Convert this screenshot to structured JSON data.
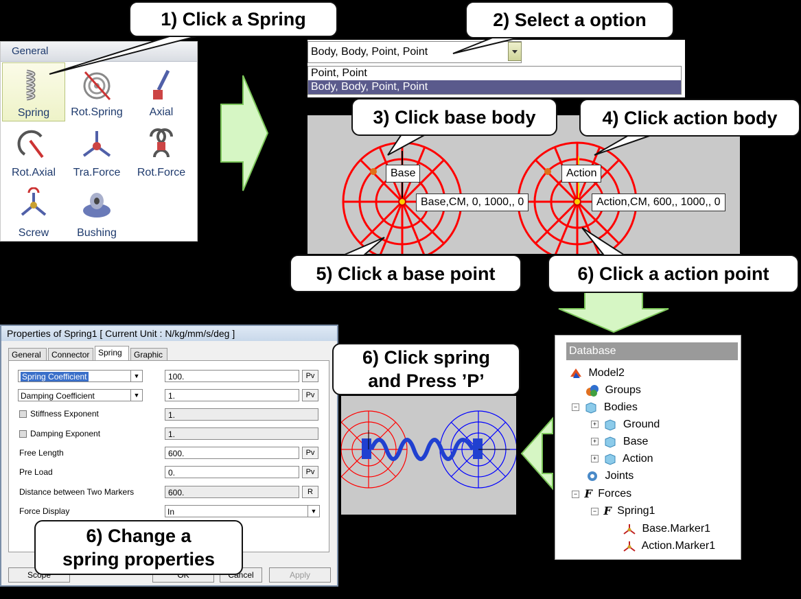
{
  "callouts": {
    "c1": "1) Click a Spring",
    "c2": "2) Select a option",
    "c3": "3) Click base body",
    "c4": "4) Click action body",
    "c5": "5) Click a base point",
    "c6": "6) Click a action point",
    "c7_l1": "6) Click spring",
    "c7_l2": "and Press ’P’",
    "c8_l1": "6) Change a",
    "c8_l2": "spring properties"
  },
  "general": {
    "header": "General",
    "tools": [
      "Spring",
      "Rot.Spring",
      "Axial",
      "Rot.Axial",
      "Tra.Force",
      "Rot.Force",
      "Screw",
      "Bushing"
    ]
  },
  "dropdown": {
    "selected": "Body, Body, Point, Point",
    "options": [
      "Point, Point",
      "Body, Body, Point, Point"
    ]
  },
  "viewport": {
    "base_label": "Base",
    "action_label": "Action",
    "base_cm": "Base,CM, 0, 1000,, 0",
    "action_cm": "Action,CM, 600,, 1000,, 0"
  },
  "dialog": {
    "title": "Properties of Spring1 [ Current Unit : N/kg/mm/s/deg ]",
    "tabs": [
      "General",
      "Connector",
      "Spring",
      "Graphic"
    ],
    "spring_coefficient_label": "Spring Coefficient",
    "damping_coefficient_label": "Damping Coefficient",
    "stiffness_exponent_label": "Stiffness Exponent",
    "damping_exponent_label": "Damping Exponent",
    "free_length_label": "Free Length",
    "pre_load_label": "Pre Load",
    "distance_label": "Distance between Two Markers",
    "force_display_label": "Force Display",
    "values": {
      "spring_coefficient": "100.",
      "damping_coefficient": "1.",
      "stiffness_exponent": "1.",
      "damping_exponent": "1.",
      "free_length": "600.",
      "pre_load": "0.",
      "distance": "600.",
      "force_display": "In"
    },
    "pv_label": "Pv",
    "r_label": "R",
    "buttons": {
      "scope": "Scope",
      "ok": "OK",
      "cancel": "Cancel",
      "apply": "Apply"
    }
  },
  "database": {
    "header": "Database",
    "model": "Model2",
    "groups": "Groups",
    "bodies": "Bodies",
    "ground": "Ground",
    "base": "Base",
    "action": "Action",
    "joints": "Joints",
    "forces": "Forces",
    "spring": "Spring1",
    "marker1": "Base.Marker1",
    "marker2": "Action.Marker1"
  },
  "colors": {
    "arrow_fill": "#d6f6c4",
    "arrow_stroke": "#7cc65a",
    "target_red": "#ff0000",
    "spring_blue": "#0000ff",
    "highlight_dash": "#e02020"
  }
}
